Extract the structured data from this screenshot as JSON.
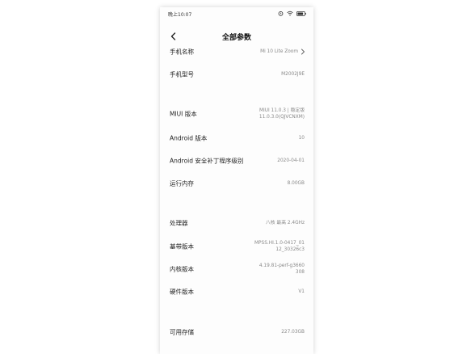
{
  "status": {
    "time": "晚上10:07"
  },
  "header": {
    "title": "全部参数"
  },
  "rows": [
    {
      "label": "手机名称",
      "value_lines": [
        "Mi 10 Lite Zoom"
      ]
    },
    {
      "label": "手机型号",
      "value_lines": [
        "M2002J9E"
      ]
    },
    {
      "label": "MIUI 版本",
      "value_lines": [
        "MIUI 11.0.3 | 稳定版",
        "11.0.3.0(QJVCNXM)"
      ]
    },
    {
      "label": "Android 版本",
      "value_lines": [
        "10"
      ]
    },
    {
      "label": "Android 安全补丁程序级别",
      "value_lines": [
        "2020-04-01"
      ]
    },
    {
      "label": "运行内存",
      "value_lines": [
        "8.00GB"
      ]
    },
    {
      "label": "处理器",
      "value_lines": [
        "八核 最高 2.4GHz"
      ]
    },
    {
      "label": "基带版本",
      "value_lines": [
        "MPSS.HI.1.0-0417_01",
        "12_30326c3"
      ]
    },
    {
      "label": "内核版本",
      "value_lines": [
        "4.19.81-perf-g3660",
        "308"
      ]
    },
    {
      "label": "硬件版本",
      "value_lines": [
        "V1"
      ]
    },
    {
      "label": "可用存储",
      "value_lines": [
        "227.03GB"
      ]
    }
  ]
}
